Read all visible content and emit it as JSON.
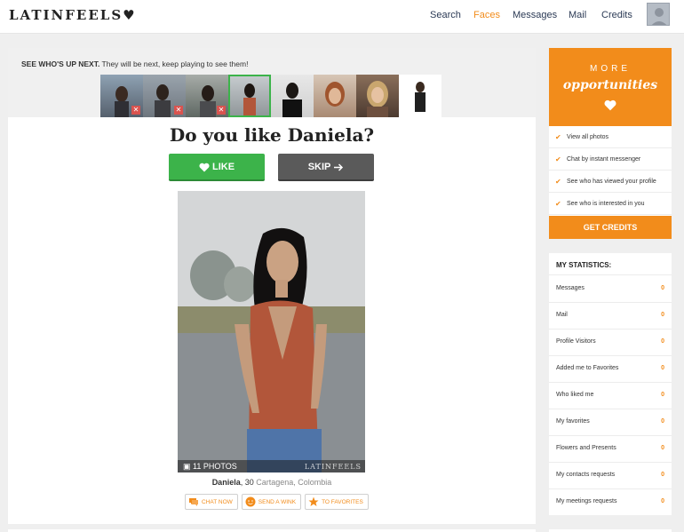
{
  "header": {
    "logo": "LATINFEELS",
    "nav": [
      {
        "label": "Search",
        "active": false
      },
      {
        "label": "Faces",
        "active": true
      },
      {
        "label": "Messages",
        "active": false
      },
      {
        "label": "Mail",
        "active": false
      },
      {
        "label": "Credits",
        "active": false
      }
    ]
  },
  "upnext": {
    "bold": "SEE WHO'S UP NEXT.",
    "text": "They will be next, keep playing to see them!"
  },
  "question": "Do you like Daniela?",
  "buttons": {
    "like": "LIKE",
    "skip": "SKIP"
  },
  "photo": {
    "count": "11 PHOTOS",
    "watermark": "LATINFEELS"
  },
  "profile": {
    "name": "Daniela",
    "age": ", 30",
    "location": "Cartagena, Colombia"
  },
  "actions": [
    {
      "label": "CHAT NOW",
      "icon": "chat-icon"
    },
    {
      "label": "SEND A WINK",
      "icon": "wink-icon"
    },
    {
      "label": "TO FAVORITES",
      "icon": "star-icon"
    }
  ],
  "promo": {
    "more": "MORE",
    "opportunities": "opportunities",
    "items": [
      "View all photos",
      "Chat by instant messenger",
      "See who has viewed your profile",
      "See who is interested in you"
    ],
    "cta": "GET CREDITS"
  },
  "stats": {
    "title": "MY STATISTICS:",
    "rows": [
      {
        "label": "Messages",
        "value": "0"
      },
      {
        "label": "Mail",
        "value": "0"
      },
      {
        "label": "Profile Visitors",
        "value": "0"
      },
      {
        "label": "Added me to Favorites",
        "value": "0"
      },
      {
        "label": "Who liked me",
        "value": "0"
      },
      {
        "label": "My favorites",
        "value": "0"
      },
      {
        "label": "Flowers and Presents",
        "value": "0"
      },
      {
        "label": "My contacts requests",
        "value": "0"
      },
      {
        "label": "My meetings requests",
        "value": "0"
      }
    ]
  },
  "colors": {
    "accent": "#f28c1b",
    "like": "#3cb34a",
    "skip": "#5a5a5a",
    "nav": "#2b3a55"
  }
}
